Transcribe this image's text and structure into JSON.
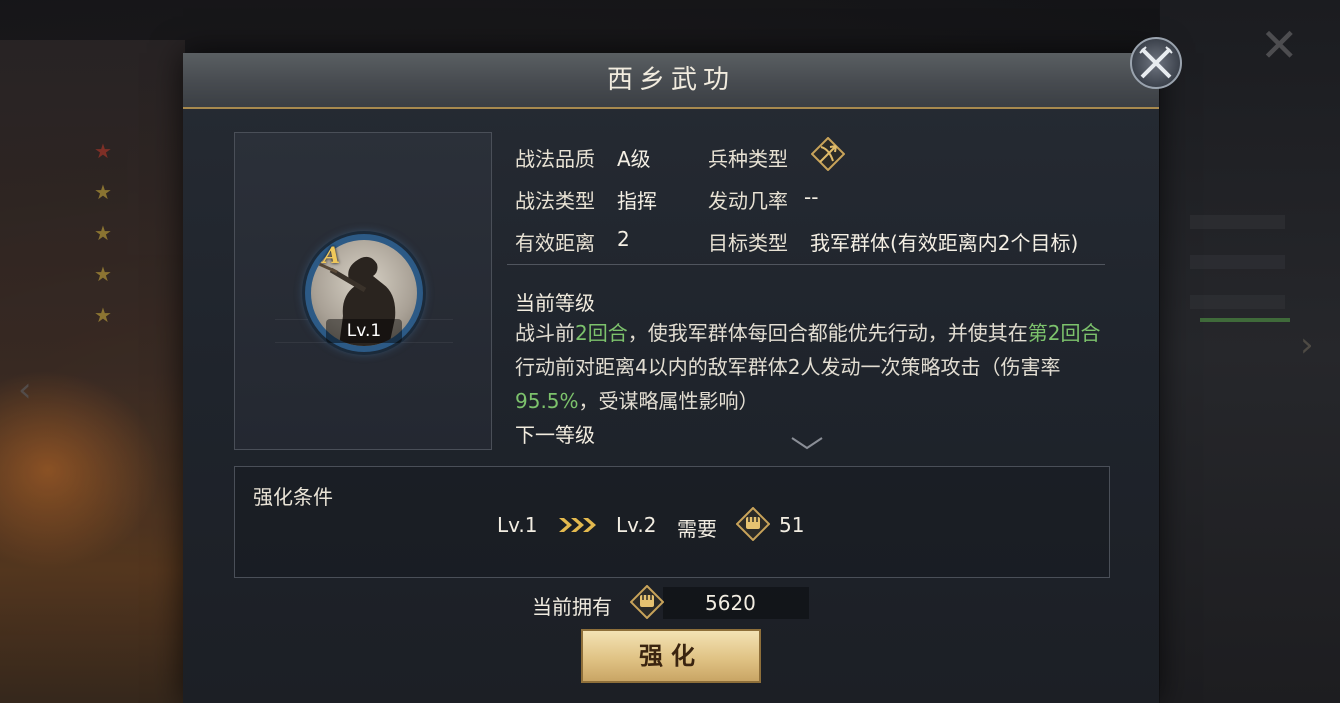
{
  "dialog": {
    "title": "西乡武功"
  },
  "portrait": {
    "grade": "A",
    "level": "Lv.1"
  },
  "info": {
    "quality_label": "战法品质",
    "quality_value": "A级",
    "troop_label": "兵种类型",
    "troop_icon": "crossed-weapons-icon",
    "tactic_type_label": "战法类型",
    "tactic_type_value": "指挥",
    "trigger_rate_label": "发动几率",
    "trigger_rate_value": "--",
    "range_label": "有效距离",
    "range_value": "2",
    "target_label": "目标类型",
    "target_value": "我军群体(有效距离内2个目标)"
  },
  "description": {
    "current_level_label": "当前等级",
    "part1": "战斗前",
    "hl1": "2回合",
    "part2": "，使我军群体每回合都能优先行动，并使其在",
    "hl2": "第2回合",
    "part3": "行动前对距离4以内的敌军群体2人发动一次策略攻击（伤害率",
    "hl3": "95.5%",
    "part4": "，受谋略属性影响）",
    "next_level_label": "下一等级"
  },
  "enhance": {
    "title": "强化条件",
    "from_level": "Lv.1",
    "to_level": "Lv.2",
    "need_label": "需要",
    "cost_icon": "fist-token-icon",
    "need_amount": "51"
  },
  "owned": {
    "label": "当前拥有",
    "amount": "5620"
  },
  "button": {
    "strengthen": "强化"
  },
  "colors": {
    "highlight_green": "#7cc26c",
    "gold": "#e0c385",
    "header": "#474b50"
  }
}
